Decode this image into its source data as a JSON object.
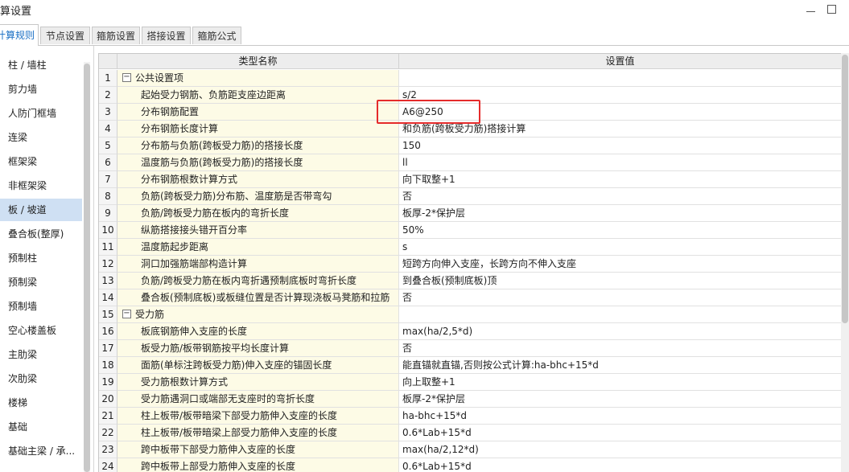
{
  "window": {
    "title": "算设置"
  },
  "tabs": [
    {
      "label": "计算规则",
      "active": true
    },
    {
      "label": "节点设置",
      "active": false
    },
    {
      "label": "箍筋设置",
      "active": false
    },
    {
      "label": "搭接设置",
      "active": false
    },
    {
      "label": "箍筋公式",
      "active": false
    }
  ],
  "sidebar": {
    "items": [
      {
        "label": "柱 / 墙柱"
      },
      {
        "label": "剪力墙"
      },
      {
        "label": "人防门框墙"
      },
      {
        "label": "连梁"
      },
      {
        "label": "框架梁"
      },
      {
        "label": "非框架梁"
      },
      {
        "label": "板 / 坡道",
        "active": true
      },
      {
        "label": "叠合板(整厚)"
      },
      {
        "label": "预制柱"
      },
      {
        "label": "预制梁"
      },
      {
        "label": "预制墙"
      },
      {
        "label": "空心楼盖板"
      },
      {
        "label": "主肋梁"
      },
      {
        "label": "次肋梁"
      },
      {
        "label": "楼梯"
      },
      {
        "label": "基础"
      },
      {
        "label": "基础主梁 / 承..."
      }
    ]
  },
  "table": {
    "headers": {
      "name": "类型名称",
      "value": "设置值"
    },
    "rows": [
      {
        "num": "1",
        "name": "公共设置项",
        "value": "",
        "group": true,
        "expand_symbol": "−"
      },
      {
        "num": "2",
        "name": "起始受力钢筋、负筋距支座边距离",
        "value": "s/2"
      },
      {
        "num": "3",
        "name": "分布钢筋配置",
        "value": "A6@250"
      },
      {
        "num": "4",
        "name": "分布钢筋长度计算",
        "value": "和负筋(跨板受力筋)搭接计算"
      },
      {
        "num": "5",
        "name": "分布筋与负筋(跨板受力筋)的搭接长度",
        "value": "150"
      },
      {
        "num": "6",
        "name": "温度筋与负筋(跨板受力筋)的搭接长度",
        "value": "ll"
      },
      {
        "num": "7",
        "name": "分布钢筋根数计算方式",
        "value": "向下取整+1"
      },
      {
        "num": "8",
        "name": "负筋(跨板受力筋)分布筋、温度筋是否带弯勾",
        "value": "否"
      },
      {
        "num": "9",
        "name": "负筋/跨板受力筋在板内的弯折长度",
        "value": "板厚-2*保护层"
      },
      {
        "num": "10",
        "name": "纵筋搭接接头错开百分率",
        "value": "50%"
      },
      {
        "num": "11",
        "name": "温度筋起步距离",
        "value": "s"
      },
      {
        "num": "12",
        "name": "洞口加强筋端部构造计算",
        "value": "短跨方向伸入支座，长跨方向不伸入支座"
      },
      {
        "num": "13",
        "name": "负筋/跨板受力筋在板内弯折遇预制底板时弯折长度",
        "value": "到叠合板(预制底板)顶"
      },
      {
        "num": "14",
        "name": "叠合板(预制底板)或板缝位置是否计算现浇板马凳筋和拉筋",
        "value": "否"
      },
      {
        "num": "15",
        "name": "受力筋",
        "value": "",
        "group": true,
        "expand_symbol": "−"
      },
      {
        "num": "16",
        "name": "板底钢筋伸入支座的长度",
        "value": "max(ha/2,5*d)"
      },
      {
        "num": "17",
        "name": "板受力筋/板带钢筋按平均长度计算",
        "value": "否"
      },
      {
        "num": "18",
        "name": "面筋(单标注跨板受力筋)伸入支座的锚固长度",
        "value": "能直锚就直锚,否则按公式计算:ha-bhc+15*d"
      },
      {
        "num": "19",
        "name": "受力筋根数计算方式",
        "value": "向上取整+1"
      },
      {
        "num": "20",
        "name": "受力筋遇洞口或端部无支座时的弯折长度",
        "value": "板厚-2*保护层"
      },
      {
        "num": "21",
        "name": "柱上板带/板带暗梁下部受力筋伸入支座的长度",
        "value": "ha-bhc+15*d"
      },
      {
        "num": "22",
        "name": "柱上板带/板带暗梁上部受力筋伸入支座的长度",
        "value": "0.6*Lab+15*d"
      },
      {
        "num": "23",
        "name": "跨中板带下部受力筋伸入支座的长度",
        "value": "max(ha/2,12*d)"
      },
      {
        "num": "24",
        "name": "跨中板带上部受力筋伸入支座的长度",
        "value": "0.6*Lab+15*d"
      }
    ]
  },
  "colors": {
    "accent": "#1a6fc4",
    "highlight_border": "#e52b2b",
    "name_cell_bg": "#fdfbe6",
    "selected_item_bg": "#cfe0f3"
  }
}
